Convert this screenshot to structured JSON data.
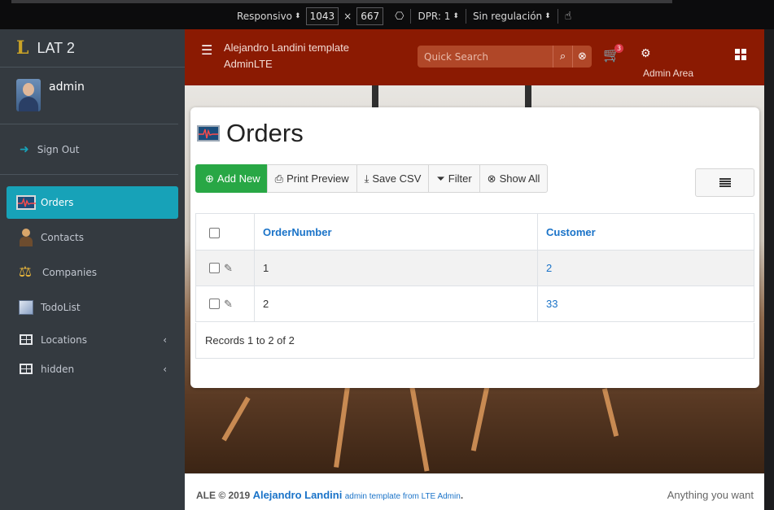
{
  "devtools": {
    "device_label": "Responsivo",
    "width": "1043",
    "times": "×",
    "height": "667",
    "dpr_label": "DPR: 1",
    "throttle_label": "Sin regulación"
  },
  "sidebar": {
    "brand_logo": "L",
    "brand_name": "LAT 2",
    "user_name": "admin",
    "signout_label": "Sign Out",
    "items": [
      {
        "label": "Orders",
        "active": true
      },
      {
        "label": "Contacts"
      },
      {
        "label": "Companies"
      },
      {
        "label": "TodoList"
      },
      {
        "label": "Locations",
        "has_children": true
      },
      {
        "label": "hidden",
        "has_children": true
      }
    ],
    "chevron": "‹"
  },
  "header": {
    "title_line1": "Alejandro Landini template",
    "title_line2": "AdminLTE",
    "search_placeholder": "Quick Search",
    "cart_count": "3",
    "admin_area_label": "Admin Area",
    "bg_color": "#8b1a02"
  },
  "page": {
    "title": "Orders",
    "toolbar": {
      "add_new": "Add New",
      "print_preview": "Print Preview",
      "save_csv": "Save CSV",
      "filter": "Filter",
      "show_all": "Show All"
    },
    "table": {
      "columns": [
        "OrderNumber",
        "Customer"
      ],
      "rows": [
        {
          "order_number": "1",
          "customer": "2"
        },
        {
          "order_number": "2",
          "customer": "33"
        }
      ]
    },
    "records_text": "Records 1 to 2 of 2"
  },
  "footer": {
    "prefix": "ALE © 2019",
    "author": "Alejandro Landini",
    "suffix": "admin template from LTE Admin",
    "dot": ".",
    "right_text": "Anything you want"
  },
  "colors": {
    "accent": "#17a2b8",
    "success": "#28a745",
    "link": "#1a73c8",
    "sidebar_bg": "#343a40"
  }
}
